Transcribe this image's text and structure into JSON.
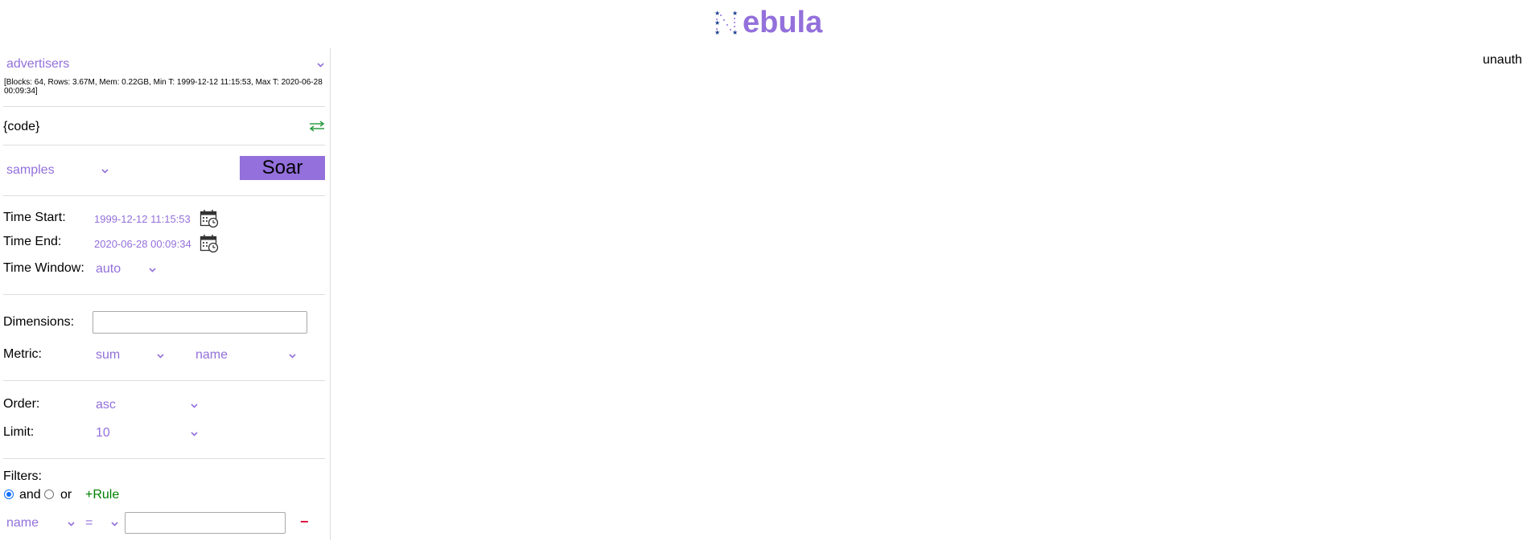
{
  "header": {
    "logo_text": "ebula",
    "user_status": "unauth"
  },
  "table": {
    "selected": "advertisers",
    "stats": "[Blocks: 64, Rows: 3.67M, Mem: 0.22GB, Min T: 1999-12-12 11:15:53, Max T: 2020-06-28 00:09:34]"
  },
  "code_label": "{code}",
  "display": {
    "selected": "samples"
  },
  "soar_label": "Soar",
  "time": {
    "start_label": "Time Start:",
    "start_value": "1999-12-12 11:15:53",
    "end_label": "Time End:",
    "end_value": "2020-06-28 00:09:34",
    "window_label": "Time Window:",
    "window_value": "auto"
  },
  "dimensions": {
    "label": "Dimensions:",
    "value": ""
  },
  "metric": {
    "label": "Metric:",
    "function": "sum",
    "column": "name"
  },
  "order": {
    "label": "Order:",
    "value": "asc"
  },
  "limit": {
    "label": "Limit:",
    "value": "10"
  },
  "filters": {
    "label": "Filters:",
    "and_label": "and",
    "or_label": "or",
    "add_rule_label": "+Rule",
    "remove_label": "−",
    "rule": {
      "column": "name",
      "operator": "=",
      "value": ""
    }
  },
  "colors": {
    "accent": "#9370db",
    "add": "#008000",
    "remove": "#dc143c"
  }
}
